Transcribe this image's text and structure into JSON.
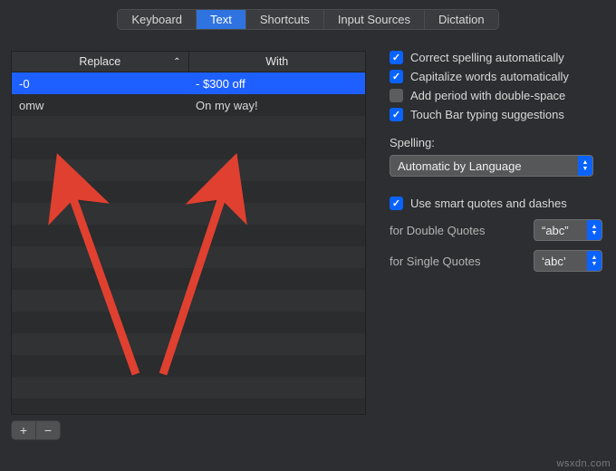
{
  "tabs": {
    "items": [
      "Keyboard",
      "Text",
      "Shortcuts",
      "Input Sources",
      "Dictation"
    ],
    "active_index": 1
  },
  "table": {
    "columns": {
      "replace": "Replace",
      "with": "With"
    },
    "sort_indicator": "⌃",
    "rows": [
      {
        "replace": "-0",
        "with": "- $300 off",
        "selected": true
      },
      {
        "replace": "omw",
        "with": "On my way!",
        "selected": false
      }
    ],
    "empty_row_count": 13
  },
  "checks": {
    "correct_spelling": {
      "label": "Correct spelling automatically",
      "checked": true
    },
    "capitalize_words": {
      "label": "Capitalize words automatically",
      "checked": true
    },
    "double_space_period": {
      "label": "Add period with double-space",
      "checked": false
    },
    "touch_bar": {
      "label": "Touch Bar typing suggestions",
      "checked": true
    }
  },
  "spelling": {
    "label": "Spelling:",
    "value": "Automatic by Language"
  },
  "smart_quotes": {
    "checked": true,
    "label": "Use smart quotes and dashes",
    "double": {
      "label": "for Double Quotes",
      "value": "“abc”"
    },
    "single": {
      "label": "for Single Quotes",
      "value": "‘abc’"
    }
  },
  "footer": {
    "add": "+",
    "remove": "−"
  },
  "watermark": "wsxdn.com",
  "colors": {
    "accent": "#0a63ff",
    "arrow": "#e0402f"
  }
}
